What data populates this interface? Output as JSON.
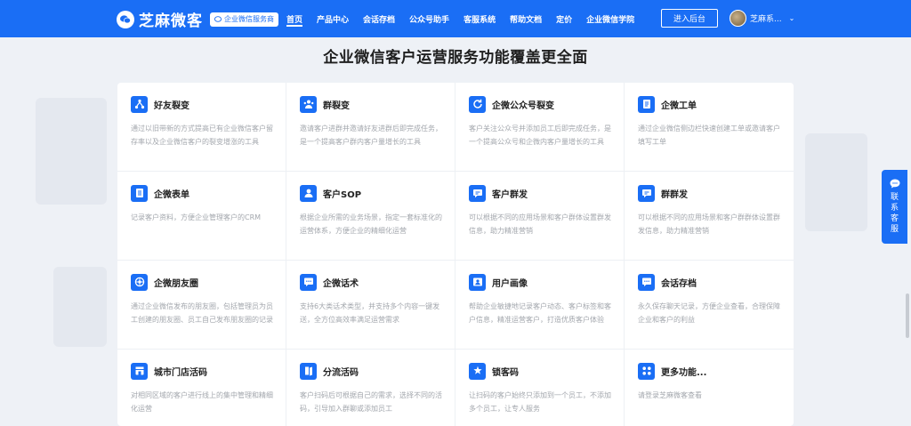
{
  "header": {
    "brand_name": "芝麻微客",
    "brand_badge": "企业微信服务商",
    "nav": [
      {
        "label": "首页",
        "active": true
      },
      {
        "label": "产品中心",
        "active": false
      },
      {
        "label": "会话存档",
        "active": false
      },
      {
        "label": "公众号助手",
        "active": false
      },
      {
        "label": "客服系统",
        "active": false
      },
      {
        "label": "帮助文档",
        "active": false
      },
      {
        "label": "定价",
        "active": false
      },
      {
        "label": "企业微信学院",
        "active": false
      }
    ],
    "admin_button": "进入后台",
    "user_name": "芝麻系...",
    "brand_color": "#1a6ef5"
  },
  "section": {
    "title": "企业微信客户运营服务功能覆盖更全面"
  },
  "features": [
    {
      "icon": "share-tree-icon",
      "title": "好友裂变",
      "desc": "通过以旧带新的方式提高已有企业微信客户留存率以及企业微信客户的裂变增涨的工具"
    },
    {
      "icon": "group-icon",
      "title": "群裂变",
      "desc": "邀请客户进群并邀请好友进群后即完成任务，是一个提高客户群内客户量增长的工具"
    },
    {
      "icon": "refresh-icon",
      "title": "企微公众号裂变",
      "desc": "客户关注公众号并添加员工后即完成任务，是一个提高公众号和企微内客户量增长的工具"
    },
    {
      "icon": "document-icon",
      "title": "企微工单",
      "desc": "通过企业微信侧边栏快速创建工单或邀请客户填写工单"
    },
    {
      "icon": "form-icon",
      "title": "企微表单",
      "desc": "记录客户资料，方便企业管理客户的CRM"
    },
    {
      "icon": "user-icon",
      "title": "客户SOP",
      "desc": "根据企业所需的业务场景，指定一套标准化的运营体系，方便企业的精细化运营"
    },
    {
      "icon": "chat-icon",
      "title": "客户群发",
      "desc": "可以根据不同的应用场景和客户群体设置群发信息，助力精准营销"
    },
    {
      "icon": "chat-icon",
      "title": "群群发",
      "desc": "可以根据不同的应用场景和客户群群体设置群发信息，助力精准营销"
    },
    {
      "icon": "camera-icon",
      "title": "企微朋友圈",
      "desc": "通过企业微信发布的朋友圈，包括管理员为员工创建的朋友圈、员工自己发布朋友圈的记录"
    },
    {
      "icon": "message-icon",
      "title": "企微话术",
      "desc": "支持6大类话术类型，并支持多个内容一键发送，全方位高效率满足运营需求"
    },
    {
      "icon": "user-profile-icon",
      "title": "用户画像",
      "desc": "帮助企业敏捷地记录客户动态、客户标签和客户信息，精准运营客户，打造优质客户体验"
    },
    {
      "icon": "message-icon",
      "title": "会话存档",
      "desc": "永久保存聊天记录，方便企业查看，合理保障企业和客户的利益"
    },
    {
      "icon": "store-icon",
      "title": "城市门店活码",
      "desc": "对相同区域的客户进行线上的集中管理和精细化运营"
    },
    {
      "icon": "split-icon",
      "title": "分流活码",
      "desc": "客户扫码后可根据自己的需求，选择不同的活码，引导加入群聊或添加员工"
    },
    {
      "icon": "lock-icon",
      "title": "锁客码",
      "desc": "让扫码的客户始终只添加到一个员工，不添加多个员工，让专人服务"
    },
    {
      "icon": "more-icon",
      "title": "更多功能...",
      "desc": "请登录芝麻微客查看"
    }
  ],
  "contact": {
    "label": "联系客服",
    "icon": "chat-bubble-icon"
  }
}
